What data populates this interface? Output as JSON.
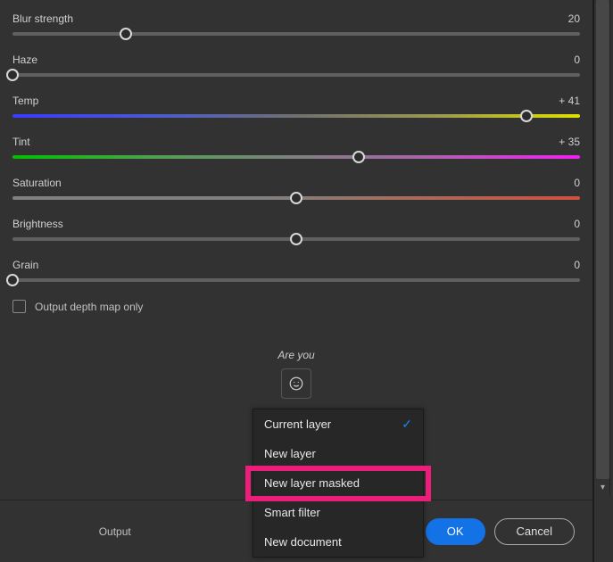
{
  "sliders": {
    "blur": {
      "label": "Blur strength",
      "value": "20",
      "pos": 20
    },
    "haze": {
      "label": "Haze",
      "value": "0",
      "pos": 0
    },
    "temp": {
      "label": "Temp",
      "value": "+ 41",
      "pos": 90.5
    },
    "tint": {
      "label": "Tint",
      "value": "+ 35",
      "pos": 61
    },
    "saturation": {
      "label": "Saturation",
      "value": "0",
      "pos": 50
    },
    "brightness": {
      "label": "Brightness",
      "value": "0",
      "pos": 50
    },
    "grain": {
      "label": "Grain",
      "value": "0",
      "pos": 0
    }
  },
  "checkbox": {
    "label": "Output depth map only"
  },
  "survey": {
    "prompt": "Are you"
  },
  "footer": {
    "output_label": "Output",
    "ok": "OK",
    "cancel": "Cancel"
  },
  "menu": {
    "items": [
      {
        "label": "Current layer",
        "selected": true
      },
      {
        "label": "New layer"
      },
      {
        "label": "New layer masked"
      },
      {
        "label": "Smart filter"
      },
      {
        "label": "New document"
      }
    ]
  }
}
